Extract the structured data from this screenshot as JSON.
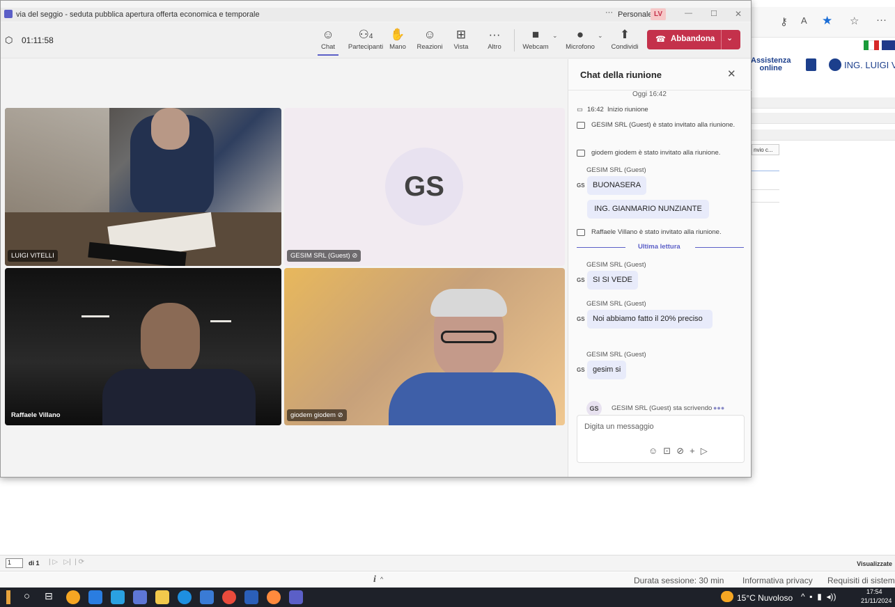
{
  "window": {
    "title": "via del seggio - seduta pubblica apertura offerta economica e temporale",
    "more": "···",
    "profile": "Personale",
    "avatar": "LV",
    "min": "—",
    "max": "☐",
    "close": "✕"
  },
  "toolbar": {
    "timer": "01:11:58",
    "participants_count": "4",
    "chat": "Chat",
    "participants": "Partecipanti",
    "hand": "Mano",
    "reactions": "Reazioni",
    "view": "Vista",
    "more": "Altro",
    "webcam": "Webcam",
    "mic": "Microfono",
    "share": "Condividi",
    "leave": "Abbandona"
  },
  "tiles": [
    {
      "name": "LUIGI VITELLI"
    },
    {
      "name": "GESIM SRL (Guest)",
      "initials": "GS"
    },
    {
      "name": "Raffaele Villano"
    },
    {
      "name": "giodem giodem"
    }
  ],
  "chat": {
    "title": "Chat della riunione",
    "date": "Oggi 16:42",
    "start_time": "16:42",
    "start_text": "Inizio riunione",
    "sys1": "GESIM SRL (Guest) è stato invitato alla riunione.",
    "sys2": "giodem giodem è stato invitato alla riunione.",
    "sender": "GESIM SRL (Guest)",
    "msg1": "BUONASERA",
    "msg2": "ING. GIANMARIO NUNZIANTE",
    "sys3": "Raffaele Villano è stato invitato alla riunione.",
    "last_read": "Ultima lettura",
    "msg3": "SI SI VEDE",
    "msg4": "Noi abbiamo fatto il 20% preciso",
    "msg5": "gesim si",
    "typing_initials": "GS",
    "typing": "GESIM SRL (Guest) sta scrivendo",
    "input_placeholder": "Digita un messaggio",
    "avatar_initials": "GS"
  },
  "browser": {
    "assist1": "Assistenza",
    "assist2": "online",
    "user": "ING. LUIGI VI",
    "tab_col": "nvio c...",
    "page_input": "1",
    "page_of": "di 1",
    "visualizzate": "Visualizzate",
    "info_i": "i",
    "session": "Durata sessione: 30 min",
    "privacy": "Informativa privacy",
    "requisiti": "Requisiti di sistem"
  },
  "taskbar": {
    "weather": "15°C Nuvoloso",
    "time": "17:54",
    "date": "21/11/2024"
  }
}
